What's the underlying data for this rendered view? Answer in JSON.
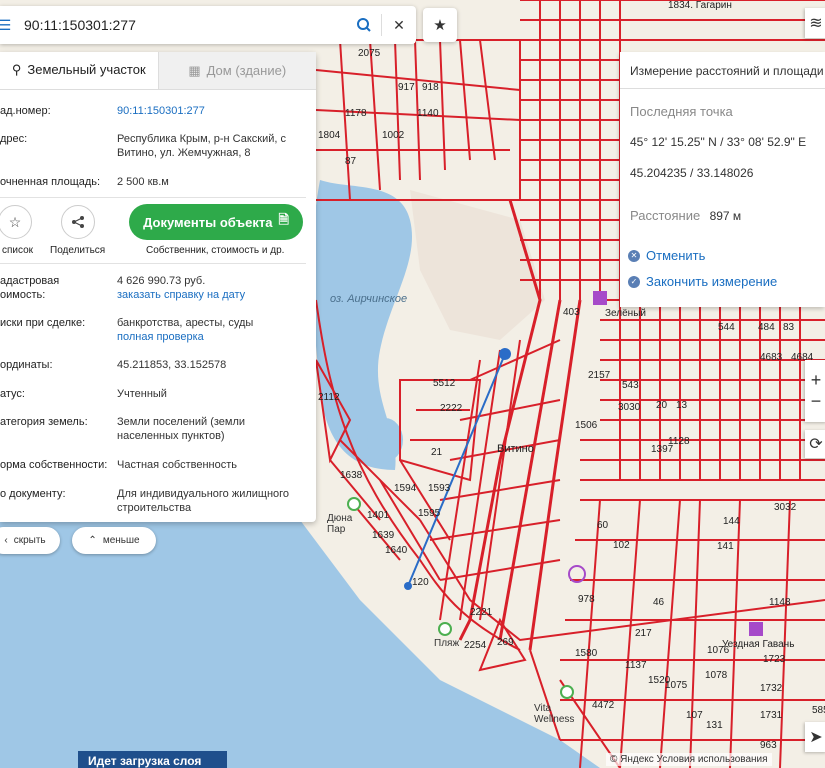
{
  "search": {
    "query": "90:11:150301:277"
  },
  "panel": {
    "tab_land": "Земельный участок",
    "tab_house": "Дом (здание)",
    "rows": [
      {
        "label": "ад.номер:",
        "value": "90:11:150301:277"
      },
      {
        "label": "дрес:",
        "value": "Республика Крым, р-н Сакский, с Витино, ул. Жемчужная, 8"
      },
      {
        "label": "очненная площадь:",
        "value": "2 500 кв.м"
      },
      {
        "label": "адастровая",
        "label2": "оимость:",
        "value": "4 626 990.73 руб.",
        "link": "заказать справку на дату"
      },
      {
        "label": "иски при сделке:",
        "value": "банкротства, аресты, суды",
        "link": "полная проверка"
      },
      {
        "label": "ординаты:",
        "value": "45.211853, 33.152578"
      },
      {
        "label": "атус:",
        "value": "Учтенный"
      },
      {
        "label": "атегория земель:",
        "value": "Земли поселений (земли населенных пунктов)"
      },
      {
        "label": "орма собственности:",
        "value": "Частная собственность"
      },
      {
        "label": "о документу:",
        "value": "Для индивидуального жилищного строительства"
      }
    ],
    "to_list": "список",
    "share": "Поделиться",
    "docs_button": "Документы объекта",
    "docs_caption": "Собственник, стоимость и др."
  },
  "pills": {
    "hide": "скрыть",
    "less": "меньше"
  },
  "measure": {
    "title": "Измерение расстояний и площади",
    "last_point_label": "Последняя точка",
    "dms": "45° 12' 15.25\" N / 33° 08' 52.9\" E",
    "decimal": "45.204235 / 33.148026",
    "distance_label": "Расстояние",
    "distance_value": "897 м",
    "cancel": "Отменить",
    "finish": "Закончить измерение"
  },
  "map": {
    "lake": "оз. Аирчинское",
    "village": "Витино",
    "poi_beach": "Пляж",
    "poi_vita": "Vita Wellness",
    "poi_duna": "Дюна Пар",
    "poi_gavan": "Уездная Гавань",
    "poi_zelen": "Зелёный",
    "top_label": "1834. Гагарин",
    "parcel_labels": [
      "2075",
      "917",
      "918",
      "1178",
      "1140",
      "1804",
      "1002",
      "87",
      "5512",
      "2222",
      "2112",
      "21",
      "1638",
      "1594",
      "1593",
      "1401",
      "1595",
      "1639",
      "1640",
      "403",
      "2157",
      "1506",
      "543",
      "3030",
      "20",
      "13",
      "1397",
      "1128",
      "544",
      "484",
      "83",
      "4683",
      "4684",
      "60",
      "102",
      "144",
      "141",
      "3032",
      "978",
      "46",
      "1148",
      "217",
      "1076",
      "1723",
      "1732",
      "1731",
      "963",
      "1580",
      "1137",
      "1520",
      "1075",
      "1078",
      "269",
      "2254",
      "120",
      "131",
      "107",
      "4472",
      "2221",
      "585"
    ],
    "loading_text": "Идет загрузка слоя",
    "copyright": "© Яндекс Условия использования"
  },
  "colors": {
    "parcel": "#d8202a",
    "water": "#9fc7e6",
    "land": "#f3efe6",
    "accent": "#1a6ec1",
    "docs": "#2eaa4a"
  }
}
